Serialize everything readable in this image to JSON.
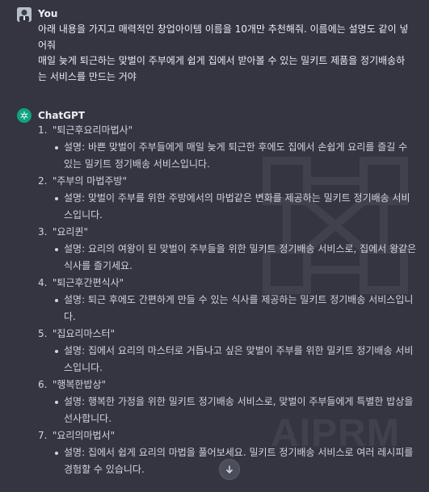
{
  "user": {
    "name": "You",
    "message_line1": "아래 내용을 가지고 매력적인 창업아이템 이름을 10개만 추천해줘. 이름에는 설명도 같이 넣어줘",
    "message_line2": "매일 늦게 퇴근하는 맞벌이 주부에게 쉽게 집에서 받아볼 수 있는 밀키트 제품을 정기배송하는 서비스를 만드는 거야"
  },
  "assistant": {
    "name": "ChatGPT",
    "items": [
      {
        "num": "1.",
        "title": "\"퇴근후요리마법사\"",
        "desc": "설명: 바쁜 맞벌이 주부들에게 매일 늦게 퇴근한 후에도 집에서 손쉽게 요리를 즐길 수 있는 밀키트 정기배송 서비스입니다."
      },
      {
        "num": "2.",
        "title": "\"주부의 마법주방\"",
        "desc": "설명: 맞벌이 주부를 위한 주방에서의 마법같은 변화를 제공하는 밀키트 정기배송 서비스입니다."
      },
      {
        "num": "3.",
        "title": "\"요리퀸\"",
        "desc": "설명: 요리의 여왕이 된 맞벌이 주부들을 위한 밀키트 정기배송 서비스로, 집에서 왕같은 식사를 즐기세요."
      },
      {
        "num": "4.",
        "title": "\"퇴근후간편식사\"",
        "desc": "설명: 퇴근 후에도 간편하게 만들 수 있는 식사를 제공하는 밀키트 정기배송 서비스입니다."
      },
      {
        "num": "5.",
        "title": "\"집요리마스터\"",
        "desc": "설명: 집에서 요리의 마스터로 거듭나고 싶은 맞벌이 주부를 위한 밀키트 정기배송 서비스입니다."
      },
      {
        "num": "6.",
        "title": "\"행복한밥상\"",
        "desc": "설명: 행복한 가정을 위한 밀키트 정기배송 서비스로, 맞벌이 주부들에게 특별한 밥상을 선사합니다."
      },
      {
        "num": "7.",
        "title": "\"요리의마법서\"",
        "desc": "설명: 집에서 쉽게 요리의 마법을 풀어보세요. 밀키트 정기배송 서비스로 여러 레시피를 경험할 수 있습니다."
      }
    ]
  },
  "watermark": {
    "brand": "AIPRM"
  },
  "colors": {
    "background": "#343541",
    "text": "#d1d5db",
    "chatgpt_green": "#10a37f"
  },
  "icons": {
    "user_avatar": "user-avatar-icon",
    "chatgpt_logo": "openai-logo-icon",
    "scroll_down": "arrow-down-icon"
  }
}
